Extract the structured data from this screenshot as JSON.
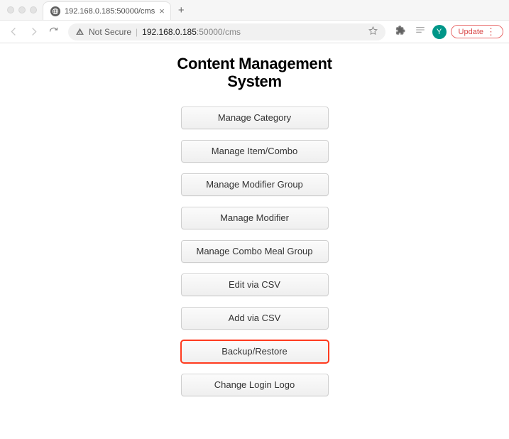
{
  "browser": {
    "tab_title": "192.168.0.185:50000/cms",
    "not_secure_label": "Not Secure",
    "url_host_prefix": "192.168.0.185",
    "url_host_suffix": ":50000/cms",
    "update_label": "Update",
    "avatar_initial": "Y"
  },
  "page": {
    "title_line1": "Content Management",
    "title_line2": "System",
    "buttons": [
      {
        "label": "Manage Category"
      },
      {
        "label": "Manage Item/Combo"
      },
      {
        "label": "Manage Modifier Group"
      },
      {
        "label": "Manage Modifier"
      },
      {
        "label": "Manage Combo Meal Group"
      },
      {
        "label": "Edit via CSV"
      },
      {
        "label": "Add via CSV"
      },
      {
        "label": "Backup/Restore",
        "highlight": true
      },
      {
        "label": "Change Login Logo"
      }
    ]
  }
}
